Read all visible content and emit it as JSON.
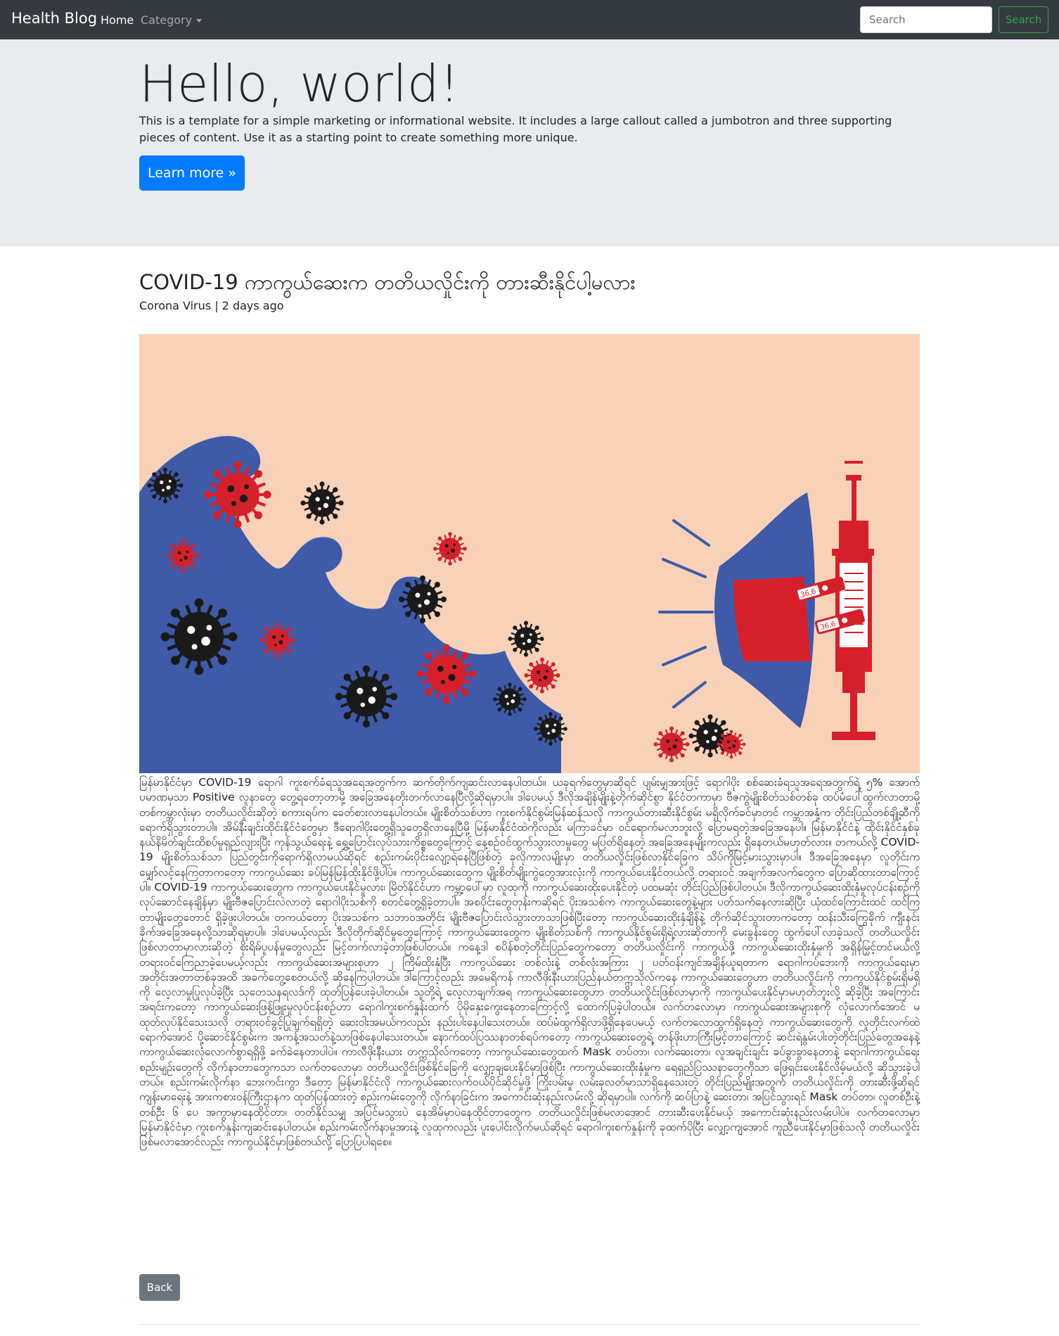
{
  "navbar": {
    "brand": "Health Blog",
    "links": [
      {
        "label": "Home"
      },
      {
        "label": "Category"
      }
    ],
    "search": {
      "placeholder": "Search",
      "button_label": "Search"
    }
  },
  "jumbotron": {
    "title": "Hello, world!",
    "text": "This is a template for a simple marketing or informational website. It includes a large callout called a jumbotron and three supporting pieces of content. Use it as a starting point to create something more unique.",
    "button_label": "Learn more »"
  },
  "post": {
    "title": "COVID-19 ကာကွယ်ဆေးက တတိယလှိုင်းကို တားဆီးနိုင်ပါ့မလား",
    "category": "Corona Virus",
    "separator": " | ",
    "time": "2 days ago",
    "image_labels": [
      "36,6",
      "36,6"
    ],
    "body": "မြန်မာနိုင်ငံမှာ COVID-19 ရောဂါ ကူးစက်ခံရသူအရေအတွက်က ဆက်တိုက်ကျဆင်းလာနေပါတယ်။ ယခုရက်တွေမှာဆိုရင် ပျမ်းမျှအားဖြင့် ရောဂါပိုး စစ်ဆေးခံရသူအရေအတွက်ရဲ့ ၅% အောက် ပမာဏမှသာ Positive လူနာတွေ တွေ့ရတော့တာမို့ အခြေအနေတိုးတက်လာနေပြီလို့ဆိုရမှာပါ။ ဒါပေမယ့် ဒီလိုအချိန်မျိုးနဲ့တိုက်ဆိုင်စွာ နိုင်ငံတကာမှာ ဗီဇကွဲမျိုးစိတ်သစ်တစ်ခု ထပ်မံပေါ်ထွက်လာတာမို့ တစ်ကမ္ဘာလုံးမှာ တတိယလှိုင်းဆိုတဲ့ စကားရပ်က ခေတ်စားလာနေပါတယ်။ မျိုးစိတ်သစ်ဟာ ကူးစက်နိုင်စွမ်းမြန်ဆန်သလို ကာကွယ်တားဆီးနိုင်စွမ်း မရှိလိုက်ခင်မှာတင် ကမ္ဘာအနှံ့က တိုင်းပြည်တစ်ချို့ဆီကို ရောက်ရှိသွားတာပါ။ အိမ်နီးချင်းထိုင်းနိုင်ငံတွေမှာ ဒီရောဂါပိုးတွေ့ရှိသူတွေရှိလာနေပြီမို့ မြန်မာနိုင်ငံထဲကိုလည်း မကြာခင်မှာ ဝင်ရောက်မလာဘူးလို့ ပြောမရတဲ့အခြေအနေပါ။ မြန်မာနိုင်ငံနဲ့ ထိုင်းနိုင်ငံနှစ်ခု နယ်နိမိတ်ချင်းထိစပ်မှုရှည်လျားပြီး ကုန်သွယ်ရေးနဲ့ ရွှေ့ပြောင်းလုပ်သားကိစ္စတွေကြောင့် နေ့စဉ်ဝင်ထွက်သွားလာမှုတွေ မပြတ်ရှိနေတဲ့ အခြေအနေမျိုးကလည်း ရှိနေတယ်မဟုတ်လား။ တကယ်လို့ COVID-19 မျိုးစိတ်သစ်သာ ပြည်တွင်းကိုရောက်ရှိလာမယ်ဆိုရင် စည်းကမ်းပိုင်းလျော့ရဲနေပြီဖြစ်တဲ့ ခုလိုကာလမျိုးမှာ တတိယလှိုင်းဖြစ်လာနိုင်ခြေက သိပ်ကိုမြင့်မားသွားမှာပါ။ ဒီအခြေအနေမှာ လူတိုင်းက မျှော်လင့်နေကြတာကတော့ ကာကွယ်ဆေး ခပ်မြန်မြန်ထိုးနိုင်ဖို့ပါပဲ။ ကာကွယ်ဆေးတွေက မျိုးစိတ်မျိုးကွဲတွေအားလုံးကို ကာကွယ်ပေးနိုင်တယ်လို့ တရားဝင် အချက်အလက်တွေက ပြောဆိုထားတာကြောင့်ပါ။ COVID-19 ကာကွယ်ဆေးတွေက ကာကွယ်ပေးနိုင်မှုလား၊ မြိတ်နိုင်ငံဟာ ကမ္ဘာ့ပေါ်မှာ လူထုကို ကာကွယ်ဆေးထိုးပေးနိုင်တဲ့ ပထမဆုံး တိုင်းပြည်ဖြစ်ပါတယ်။ ဒီလိုကာကွယ်ဆေးထိုးနှံမှုလုပ်ငန်းစဉ်ကို လုပ်ဆောင်နေချိန်မှာ မျိုးဗီဇပြောင်းလဲလာတဲ့ ရောဂါပိုးသစ်ကို စတင်တွေ့ရှိခဲ့တာပါ။ အစပိုင်းတွေတုန်းကဆိုရင် ပိုးအသစ်က ကာကွယ်ဆေးတွေနဲ့များ ပတ်သက်နေလားဆိုပြီး ယုံထင်ကြောင်းထင် ထင်ကြတာမျိုးတွေတောင် ရှိခဲ့ဖူးပါတယ်။ တကယ်တော့ ပိုးအသစ်က သဘာဝအတိုင်း မျိုးဗီဇပြောင်းလဲသွားတာသာဖြစ်ပြီးတော့ ကာကွယ်ဆေးထိုးနှံချိန်နဲ့ တိုက်ဆိုင်သွားတာကတော့ ထန်းသီးကြွေခိုက် ကျီးနင်းခိုက်အခြေအနေလို့သာဆိုရမှာပါ။ ဒါပေမယ့်လည်း ဒီလိုတိုက်ဆိုင်မှုတွေကြောင့် ကာကွယ်ဆေးတွေက မျိုးစိတ်သစ်ကို ကာကွယ်နိုင်စွမ်းရှိရဲ့လားဆိုတာကို မေးခွန်းတွေ ထွက်ပေါ်လာခဲ့သလို တတိယလှိုင်းဖြစ်လာတာမှာလားဆိုတဲ့ စိုးရိမ်ပူပန်မှုတွေလည်း မြင့်တက်လာခဲ့တာဖြစ်ပါတယ်။ ကနေ့ဒါ စပိန်စတဲ့တိုင်းပြည်တွေကတော့ တတိယလှိုင်းကို ကာကွယ်ဖို့ ကာကွယ်ဆေးထိုးနှံမှုကို အရှိန်မြှင့်တင်မယ်လို့ တရားဝင်ကြေညာခဲ့ပေမယ့်လည်း ကာကွယ်ဆေးအများစုဟာ ၂ ကြိမ်ထိုးနှံပြီး ကာကွယ်ဆေး တစ်လုံးနဲ့ တစ်လုံးအကြား ၂ ပတ်ဝန်းကျင်အချိန်ယူရတာက ရောဂါကပ်ဘေးကို ကာကွယ်ရေးမှာ အတိုင်းအတာတစ်ခုအထိ အခက်တွေ့စေတယ်လို့ ဆိုနေကြပါတယ်။ ဒါကြောင့်လည်း အမေရိကန် ကာလီဖိုးနီးယားပြည်နယ်တက္ကသိုလ်ကနေ ကာကွယ်ဆေးတွေဟာ တတိယလှိုင်းကို ကာကွယ်နိုင်စွမ်းရှိမရှိကို လေ့လာမှုပြုလုပ်ခဲ့ပြီး သုတေသနရလဒ်ကို ထုတ်ပြန်ပေးခဲ့ပါတယ်။ သူတို့ရဲ့ လေ့လာချက်အရ ကာကွယ်ဆေးတွေဟာ တတိယလှိုင်းဖြစ်လာမှာကို ကာကွယ်ပေးနိုင်မှာမဟုတ်ဘူးလို့ ဆိုခဲ့ပြီး အကြောင်းအရင်းကတော့ ကာကွယ်ဆေးဖြန့်ဖြူးမှုလုပ်ငန်းစဉ်ဟာ ရောဂါကူးစက်နှုန်းထက် ပိုမိုနှေးကွေးနေတာကြောင့်လို့ ထောက်ပြခဲ့ပါတယ်။ လက်တလောမှာ ကာကွယ်ဆေးအများစုကို လုံလောက်အောင် မထုတ်လုပ်နိုင်သေးသလို တရားဝင်ခွင့်ပြုချက်ရရှိတဲ့ ဆေးဝါးအမယ်ကလည်း နည်းပါးနေပါသေးတယ်။ ထပ်မံထွက်ရှိလာဖို့ရှိနေပေမယ့် လက်တလောထွက်ရှိနေတဲ့ ကာကွယ်ဆေးတွေကို လူတိုင်းလက်ထဲရောက်အောင် ပို့ဆောင်နိုင်စွမ်းက အကန့်အသတ်နဲ့သာဖြစ်နေပါသေးတယ်။ နောက်ထပ်ပြဿနာတစ်ရပ်ကတော့ ကာကွယ်ဆေးတွေရဲ့ တန်ဖိုးဟာကြီးမြင့်တာကြောင့် ဆင်းရဲနွမ်းပါးတဲ့တိုင်းပြည်တွေအနေနဲ့ ကာကွယ်ဆေးလုံလောက်စွာရရှိဖို့ ခက်ခဲနေတာပါပဲ။ ကာလီဖိုးနီးယား တက္ကသိုလ်ကတော့ ကာကွယ်ဆေးတွေထက် Mask တပ်တာ၊ လက်ဆေးတာ၊ လူအချင်းချင်း ခပ်ခွာခွာနေတာနဲ့ ရောဂါကာကွယ်ရေး စည်းမျဉ်းတွေကို လိုက်နာတာတွေကသာ လက်တလောမှာ တတိယလှိုင်းဖြစ်နိုင်ခြေကို လျှော့ချပေးနိုင်မှာဖြစ်ပြီး ကာကွယ်ဆေးထိုးနှံမှုက ရေရှည်ပြဿနာတွေကိုသာ ဖြေရှင်းပေးနိုင်လိမ့်မယ်လို့ ဆိုသွားခဲ့ပါတယ်။ စည်းကမ်းလိုက်နာ ဘေးကင်းကွာ ဒီတော့ မြန်မာနိုင်ငံလို ကာကွယ်ဆေးလက်ဝယ်ပိုင်ဆိုင်မှုဖို့ ကြိုးပမ်းမှု လမ်းခုလတ်မှာသာရှိနေသေးတဲ့ တိုင်းပြည်မျိုးအတွက် တတိယလှိုင်းကို တားဆီးဖို့ဆိုရင် ကျန်းမာရေးနဲ့ အားကစားဝန်ကြီးဌာနက ထုတ်ပြန်ထားတဲ့ စည်းကမ်းတွေကို လိုက်နာခြင်းက အကောင်းဆုံးနည်းလမ်းလို့ ဆိုရမှာပါ။ လက်ကို ဆပ်ပြာနဲ့ ဆေးတာ၊ အပြင်သွားရင် Mask တပ်တာ၊ လူတစ်ဦးနဲ့တစ်ဦး ၆ ပေ အကွာမှာနေထိုင်တာ၊ တတ်နိုင်သမျှ အပြင်မသွားပဲ နေအိမ်မှာပဲနေထိုင်တာတွေက တတိယလှိုင်းဖြစ်မလာအောင် တားဆီးပေးနိုင်မယ့် အကောင်းဆုံးနည်းလမ်းပါပဲ။ လက်တလောမှာ မြန်မာနိုင်ငံမှာ ကူးစက်နှုန်းကျဆင်းနေပါတယ်။ စည်းကမ်းလိုက်နာမှုအားနဲ့ လူထုကလည်း ပူးပေါင်းလိုက်မယ်ဆိုရင် ရောဂါကူးစက်နှုန်းကို ခုထက်ပိုပြီး လျှော့ကျအောင် ကူညီပေးနိုင်မှာဖြစ်သလို တတိယလှိုင်းဖြစ်မလာအောင်လည်း ကာကွယ်နိုင်မှာဖြစ်တယ်လို့ ပြောပြပါရစေ။",
    "back_label": "Back"
  },
  "colors": {
    "navbar_bg": "#343a40",
    "jumbotron_bg": "#e9ecef",
    "primary": "#007bff",
    "success": "#28a745",
    "secondary": "#6c757d",
    "image_bg": "#f7d2b8",
    "virus_red": "#d5202a",
    "wave_blue": "#3f5aa9"
  }
}
